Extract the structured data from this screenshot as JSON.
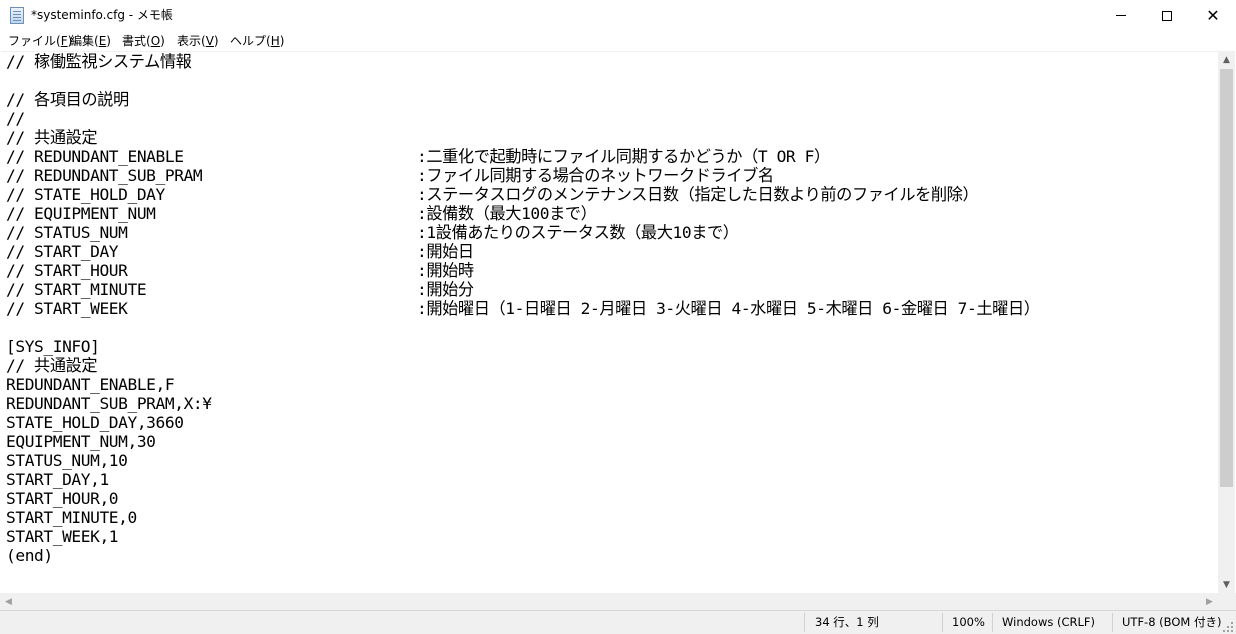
{
  "window": {
    "title": "*systeminfo.cfg - メモ帳",
    "minimize_glyph": "minimize",
    "maximize_glyph": "maximize",
    "close_glyph": "✕"
  },
  "menu": [
    {
      "label": "ファイル(",
      "key": "F",
      "suffix": ")"
    },
    {
      "label": "編集(",
      "key": "E",
      "suffix": ")"
    },
    {
      "label": "書式(",
      "key": "O",
      "suffix": ")"
    },
    {
      "label": "表示(",
      "key": "V",
      "suffix": ")"
    },
    {
      "label": "ヘルプ(",
      "key": "H",
      "suffix": ")"
    }
  ],
  "editor": {
    "lines": [
      {
        "text": "// 稼働監視システム情報",
        "desc": ""
      },
      {
        "text": "",
        "desc": ""
      },
      {
        "text": "// 各項目の説明",
        "desc": ""
      },
      {
        "text": "//",
        "desc": ""
      },
      {
        "text": "// 共通設定",
        "desc": ""
      },
      {
        "text": "// REDUNDANT_ENABLE",
        "desc": ":二重化で起動時にファイル同期するかどうか（T OR F）"
      },
      {
        "text": "// REDUNDANT_SUB_PRAM",
        "desc": ":ファイル同期する場合のネットワークドライブ名"
      },
      {
        "text": "// STATE_HOLD_DAY",
        "desc": ":ステータスログのメンテナンス日数（指定した日数より前のファイルを削除）"
      },
      {
        "text": "// EQUIPMENT_NUM",
        "desc": ":設備数（最大100まで）"
      },
      {
        "text": "// STATUS_NUM",
        "desc": ":1設備あたりのステータス数（最大10まで）"
      },
      {
        "text": "// START_DAY",
        "desc": ":開始日"
      },
      {
        "text": "// START_HOUR",
        "desc": ":開始時"
      },
      {
        "text": "// START_MINUTE",
        "desc": ":開始分"
      },
      {
        "text": "// START_WEEK",
        "desc": ":開始曜日（1-日曜日 2-月曜日 3-火曜日 4-水曜日 5-木曜日 6-金曜日 7-土曜日）"
      },
      {
        "text": "",
        "desc": ""
      },
      {
        "text": "[SYS_INFO]",
        "desc": ""
      },
      {
        "text": "// 共通設定",
        "desc": ""
      },
      {
        "text": "REDUNDANT_ENABLE,F",
        "desc": ""
      },
      {
        "text": "REDUNDANT_SUB_PRAM,X:¥",
        "desc": ""
      },
      {
        "text": "STATE_HOLD_DAY,3660",
        "desc": ""
      },
      {
        "text": "EQUIPMENT_NUM,30",
        "desc": ""
      },
      {
        "text": "STATUS_NUM,10",
        "desc": ""
      },
      {
        "text": "START_DAY,1",
        "desc": ""
      },
      {
        "text": "START_HOUR,0",
        "desc": ""
      },
      {
        "text": "START_MINUTE,0",
        "desc": ""
      },
      {
        "text": "START_WEEK,1",
        "desc": ""
      },
      {
        "text": "(end)",
        "desc": ""
      }
    ]
  },
  "scrollbars": {
    "up": "▲",
    "down": "▼",
    "left": "◀",
    "right": "▶"
  },
  "status": {
    "position": "34 行、1 列",
    "zoom": "100%",
    "line_ending": "Windows (CRLF)",
    "encoding": "UTF-8 (BOM 付き)"
  },
  "colors": {
    "chrome": "#f0f0f0",
    "thumb": "#cdcdcd",
    "text": "#000000"
  }
}
